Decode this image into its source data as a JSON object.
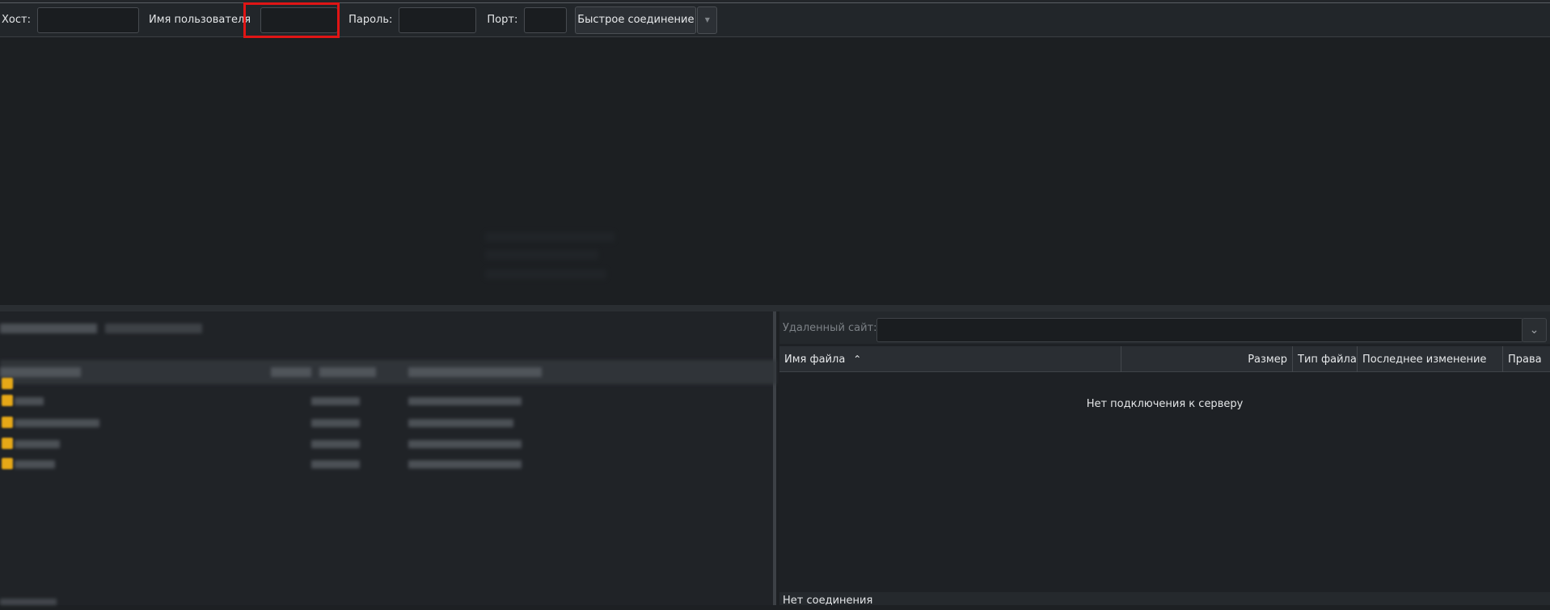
{
  "quickconnect": {
    "host_label": "Хост:",
    "host_value": "",
    "username_label": "Имя пользователя",
    "username_value": "",
    "password_label": "Пароль:",
    "password_value": "",
    "port_label": "Порт:",
    "port_value": "",
    "connect_button": "Быстрое соединение"
  },
  "remote": {
    "site_label": "Удаленный сайт:",
    "site_value": "",
    "columns": [
      {
        "label": "Имя файла"
      },
      {
        "label": "Размер"
      },
      {
        "label": "Тип файла"
      },
      {
        "label": "Последнее изменение"
      },
      {
        "label": "Права"
      }
    ],
    "empty_message": "Нет подключения к серверу",
    "status": "Нет соединения"
  },
  "colors": {
    "background": "#1d2023",
    "highlight": "#e01515",
    "folder": "#e6a817"
  }
}
